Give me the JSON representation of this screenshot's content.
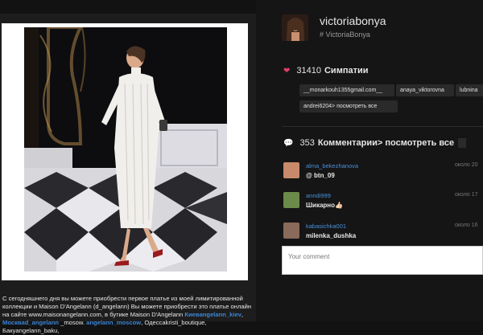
{
  "post": {
    "caption_parts": [
      "С сегодняшнего дня вы можете приобрести первое платье из моей лимитированной коллекции и Maison D'Angelann (d_angelann) Вы можете приобрести это платье онлайн на сайте www.maisonangelann.com, в бутике Maison D'Angelann ",
      "Киевangelann_kiev",
      ", ",
      "Москвad_angelann",
      " _mosow. ",
      "angelann_moscow",
      ", Одессаkristi_boutique, Бакуangelann_baku,"
    ]
  },
  "profile": {
    "username": "victoriabonya",
    "hashtag": "# VictoriaBonya"
  },
  "likes": {
    "count": "31410",
    "label": "Симпатии",
    "users": [
      "__monarkouh1355gmail.com__",
      "anaya_viktorovna",
      "lubnina",
      "andrei6204> посмотреть все"
    ]
  },
  "comments": {
    "count": "353",
    "label": "Комментарии> посмотреть все",
    "items": [
      {
        "user": "alma_bekezhanova",
        "text": "@ btn_09",
        "time": "около 20"
      },
      {
        "user": "anndi999",
        "text": "Шикарно👍🏻",
        "time": "около 17"
      },
      {
        "user": "kabasichka001",
        "text": "milenka_dushka",
        "time": "около 16"
      }
    ],
    "input_placeholder": "Your comment"
  },
  "colors": {
    "accent_link": "#4a90d9",
    "heart": "#e0406a",
    "background": "#121212"
  }
}
